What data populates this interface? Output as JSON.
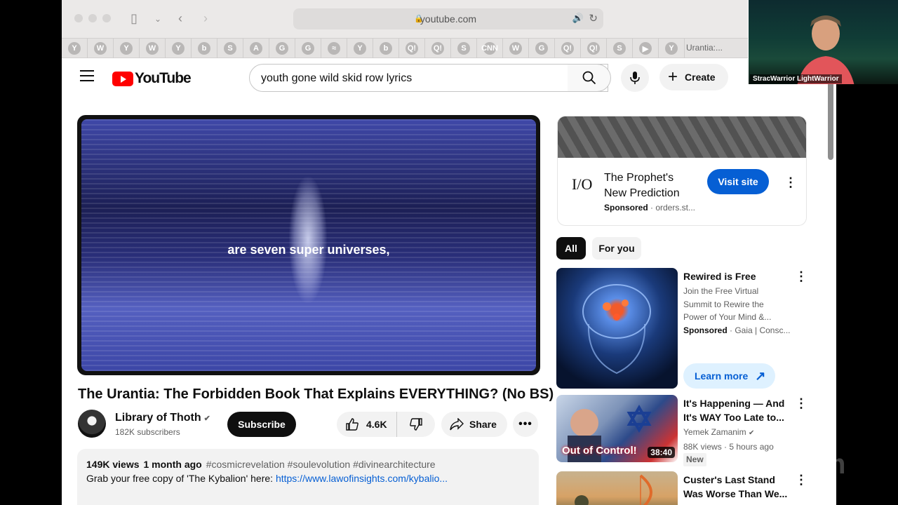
{
  "browser": {
    "url": "youtube.com",
    "favorites": [
      "Y",
      "W",
      "Y",
      "W",
      "Y",
      "b",
      "S",
      "A",
      "G",
      "G",
      "≈",
      "Y",
      "b",
      "Q!",
      "Q!",
      "S",
      "CNN",
      "W",
      "G",
      "Q!",
      "Q!",
      "S",
      "▶",
      "Y"
    ],
    "last_favorite": "Urantia:..."
  },
  "youtube": {
    "logo_text": "YouTube",
    "search_value": "youth gone wild skid row lyrics",
    "create_label": "Create"
  },
  "video": {
    "caption": "are seven super universes,",
    "title": "The Urantia: The Forbidden Book That Explains EVERYTHING? (No BS)",
    "channel": "Library of Thoth",
    "subscribers": "182K subscribers",
    "subscribe_label": "Subscribe",
    "likes": "4.6K",
    "share_label": "Share",
    "views": "149K views",
    "age": "1 month ago",
    "tags": "#cosmicrevelation #soulevolution #divinearchitecture",
    "desc_text": "Grab your free copy of 'The Kybalion' here: ",
    "desc_link": "https://www.lawofinsights.com/kybalio..."
  },
  "ad": {
    "logo": "I/O",
    "title": "The Prophet's New Prediction",
    "sponsored": "Sponsored",
    "domain": " · orders.st...",
    "cta": "Visit site"
  },
  "chips": [
    "All",
    "For you"
  ],
  "recommendations": [
    {
      "title": "Rewired is Free",
      "line1": "Join the Free Virtual",
      "line2": "Summit to Rewire the",
      "line3": "Power of Your Mind &...",
      "sponsored": "Sponsored",
      "source": " · Gaia | Consc...",
      "cta": "Learn more"
    },
    {
      "title": "It's Happening — And It's WAY Too Late to...",
      "channel": "Yemek Zamanim",
      "stats": "88K views · 5 hours ago",
      "badge": "New",
      "thumb_text": "Out of Control!",
      "duration": "38:40"
    },
    {
      "title": "Custer's Last Stand Was Worse Than We..."
    }
  ],
  "webcam": {
    "name": "StracWarrior LightWarrior"
  },
  "overlay": {
    "zoom": "zoom"
  },
  "colors": {
    "accent": "#065fd4",
    "youtube_red": "#ff0000",
    "subscribe": "#0f0f0f"
  }
}
